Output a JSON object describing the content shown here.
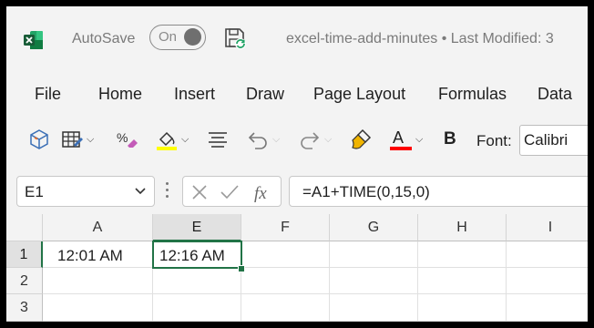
{
  "titlebar": {
    "autosave_label": "AutoSave",
    "autosave_state": "On",
    "document_title": "excel-time-add-minutes • Last Modified: 3"
  },
  "menu": [
    "File",
    "Home",
    "Insert",
    "Draw",
    "Page Layout",
    "Formulas",
    "Data"
  ],
  "ribbon": {
    "font_label": "Font:",
    "font_value": "Calibri",
    "bold_label": "B",
    "highlight_color": "#ffff00",
    "font_color": "#ff0000"
  },
  "formula_bar": {
    "name_box": "E1",
    "formula": "=A1+TIME(0,15,0)"
  },
  "grid": {
    "columns": [
      "A",
      "E",
      "F",
      "G",
      "H",
      "I"
    ],
    "rows": [
      "1",
      "2",
      "3"
    ],
    "cells": {
      "A1": "12:01 AM",
      "E1": "12:16 AM"
    },
    "selected_cell": "E1"
  },
  "colors": {
    "excel_green": "#217346"
  }
}
